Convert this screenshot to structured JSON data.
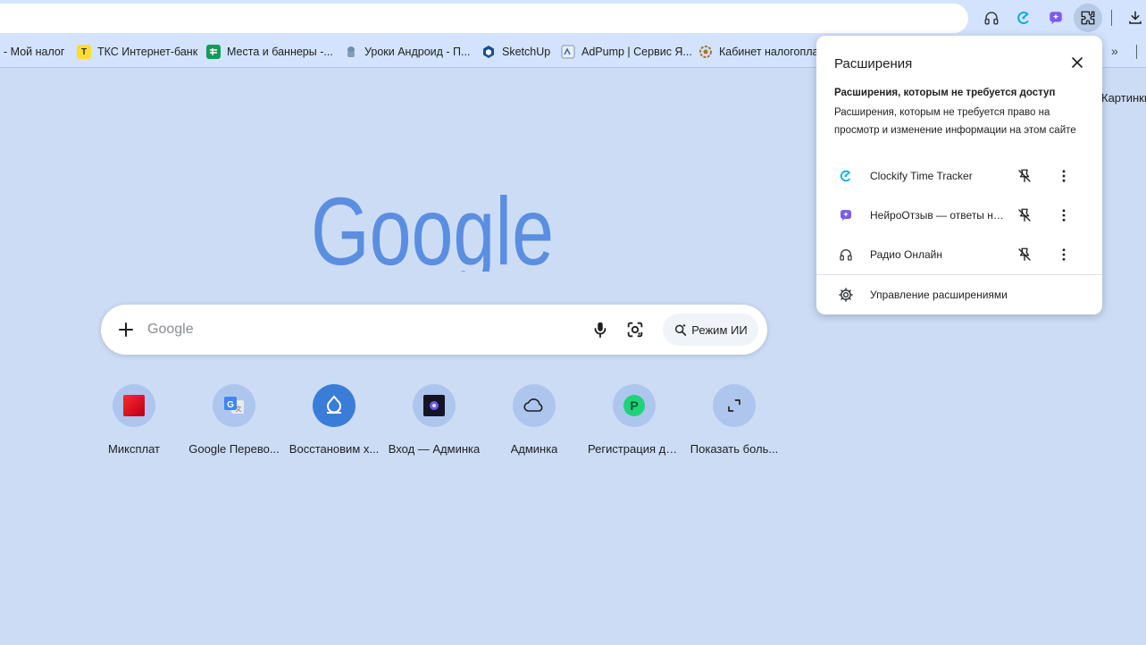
{
  "toolbar": {
    "icons": [
      "headphones-icon",
      "clockify-icon",
      "neiro-icon",
      "extensions-puzzle-icon",
      "download-icon"
    ]
  },
  "bookmarks": [
    {
      "label": "- Мой налог",
      "icon": "none"
    },
    {
      "label": "ТКС Интернет-банк",
      "icon": "tks-icon"
    },
    {
      "label": "Места и баннеры -...",
      "icon": "sheets-icon"
    },
    {
      "label": "Уроки Андроид - П...",
      "icon": "android-icon"
    },
    {
      "label": "SketchUp",
      "icon": "sketchup-icon"
    },
    {
      "label": "AdPump | Сервис Я...",
      "icon": "adpump-icon"
    },
    {
      "label": "Кабинет налогопла...",
      "icon": "nalog-icon"
    }
  ],
  "right_link": "Картинки",
  "search": {
    "placeholder": "Google",
    "ai_mode_label": "Режим ИИ"
  },
  "shortcuts": [
    {
      "label": "Миксплат",
      "icon": "mixplat-icon"
    },
    {
      "label": "Google Перево...",
      "icon": "google-translate-icon"
    },
    {
      "label": "Восстановим х...",
      "icon": "restore-icon"
    },
    {
      "label": "Вход — Админка",
      "icon": "admin-login-icon"
    },
    {
      "label": "Админка",
      "icon": "cloud-icon"
    },
    {
      "label": "Регистрация до...",
      "icon": "registration-icon"
    },
    {
      "label": "Показать боль...",
      "icon": "expand-icon"
    }
  ],
  "extensions_popup": {
    "title": "Расширения",
    "section_heading": "Расширения, которым не требуется доступ",
    "section_description": "Расширения, которым не требуется право на просмотр и изменение информации на этом сайте",
    "items": [
      {
        "name": "Clockify Time Tracker",
        "icon": "clockify-icon"
      },
      {
        "name": "НейроОтзыв — ответы на отзывы",
        "icon": "neiro-icon"
      },
      {
        "name": "Радио Онлайн",
        "icon": "headphones-icon"
      }
    ],
    "manage_label": "Управление расширениями"
  },
  "colors": {
    "page_bg": "#cbdcf4",
    "toolbar_bg": "#d3e3fd",
    "google_blue": "#5b8ee0",
    "clockify": "#03a9f4",
    "neiro": "#7c5cf0"
  }
}
